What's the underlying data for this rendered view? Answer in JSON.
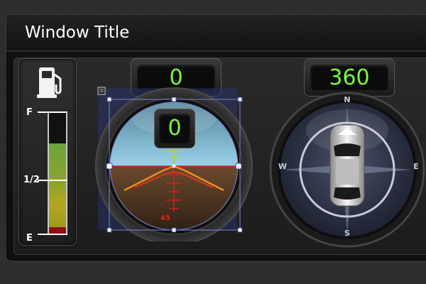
{
  "window": {
    "title": "Window Title"
  },
  "fuel_gauge": {
    "labels": {
      "full": "F",
      "half": "1/2",
      "empty": "E"
    },
    "level_fraction": 0.75,
    "icon": "fuel-pump-icon"
  },
  "attitude_indicator": {
    "top_readout": "0",
    "inner_readout": "0",
    "pitch_label": "45",
    "sky_color": "#9ad3ea",
    "ground_color": "#6b4a2e"
  },
  "compass": {
    "heading_readout": "360",
    "cardinals": {
      "north": "N",
      "east": "E",
      "south": "S",
      "west": "W"
    },
    "icon": "car-icon"
  },
  "colors": {
    "readout_text": "#7CFC3A",
    "fuel_green": "#6aa33a",
    "fuel_yellow": "#b7a51f",
    "fuel_red": "#8f1010",
    "selection": "#2b3b8f"
  }
}
